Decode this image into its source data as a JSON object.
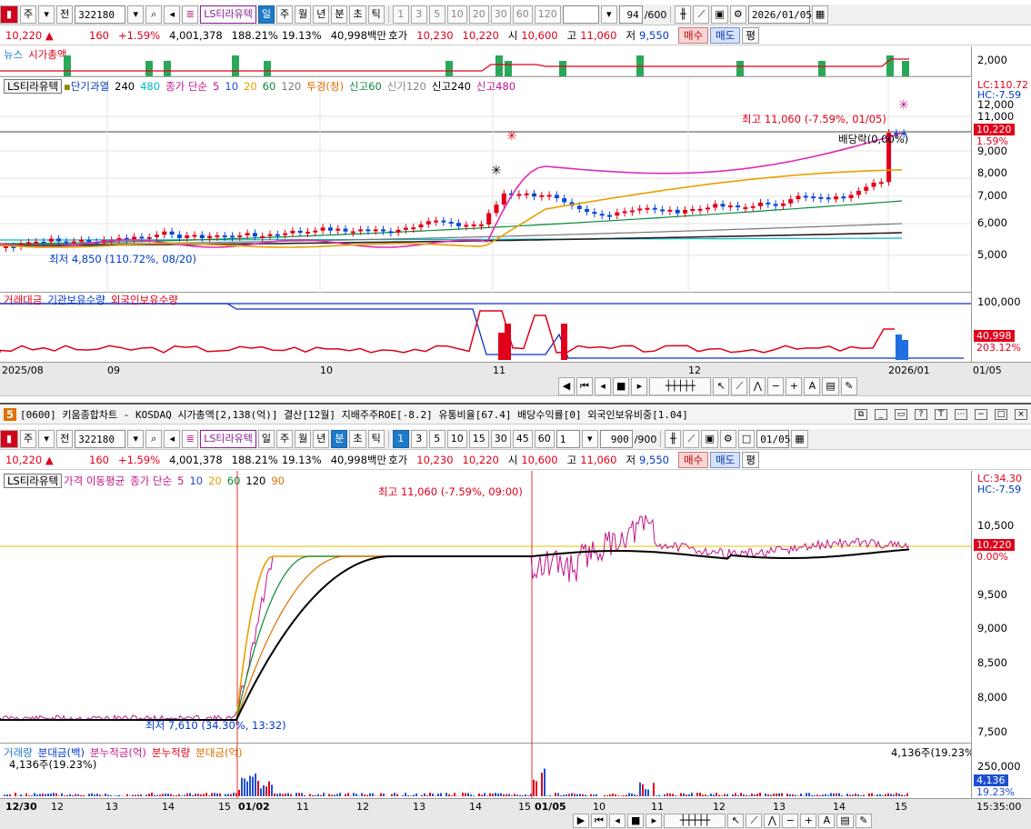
{
  "top_toolbar": {
    "market": "주",
    "prev": "전",
    "code": "322180",
    "stock_name": "LS티라유텍",
    "periods": [
      "일",
      "주",
      "월",
      "년",
      "분",
      "초",
      "틱"
    ],
    "period_selected": "일",
    "intervals": [
      "1",
      "3",
      "5",
      "10",
      "20",
      "30",
      "60",
      "120"
    ],
    "count": "94",
    "count_total": "/600",
    "date": "2026/01/05"
  },
  "top_quote": {
    "price": "10,220",
    "change": "160",
    "change_pct": "+1.59%",
    "volume": "4,001,378",
    "vol_ratio": "188.21%",
    "turnover": "19.13%",
    "amount": "40,998백만",
    "hoga_label": "호가",
    "ask": "10,230",
    "bid": "10,220",
    "open_label": "시",
    "open": "10,600",
    "high_label": "고",
    "high": "11,060",
    "low_label": "저",
    "low": "9,550",
    "buy": "매수",
    "sell": "매도",
    "flat": "평"
  },
  "top_news_legend": {
    "news": "뉴스",
    "mcap": "시가총액"
  },
  "top_news_axis": "2,000",
  "top_price_legend": {
    "name": "LS티라유텍",
    "ma_title": "단기과열",
    "ma_240": "240",
    "ma_480": "480",
    "close_simple": "종가 단순",
    "ma5": "5",
    "ma10": "10",
    "ma20": "20",
    "ma60": "60",
    "ma120": "120",
    "t1": "투경(청)",
    "t2": "신고60",
    "t3": "신가120",
    "t4": "신고240",
    "t5": "신고480"
  },
  "top_price_axis": {
    "lc": "LC:110.72",
    "hc": "HC:-7.59",
    "ticks": [
      "12,000",
      "11,000",
      "9,000",
      "8,000",
      "7,000",
      "6,000",
      "5,000"
    ],
    "current": "10,220",
    "current_pct": "1.59%"
  },
  "top_annotations": {
    "high": "최고 11,060 (-7.59%, 01/05)",
    "dividend": "배당락(0,00%)",
    "low": "최저 4,850 (110.72%, 08/20)"
  },
  "top_volume_legend": {
    "a": "거래대금",
    "b": "기관보유수량",
    "c": "외국인보유수량"
  },
  "top_volume_axis": {
    "tick": "100,000",
    "current": "40,998",
    "pct": "203.12%"
  },
  "top_xaxis": [
    "2025/08",
    "09",
    "10",
    "11",
    "12",
    "2026/01",
    "01/05"
  ],
  "sub_window": {
    "number": "5",
    "title": "[0600] 키움종합차트 - KOSDAQ 시가총액[2,138(억)] 결산[12월] 지배주주ROE[-8.2] 유통비율[67.4] 배당수익률[0] 외국인보유비중[1.04]"
  },
  "bottom_toolbar": {
    "market": "주",
    "prev": "전",
    "code": "322180",
    "stock_name": "LS티라유텍",
    "periods": [
      "일",
      "주",
      "월",
      "년",
      "분",
      "초",
      "틱"
    ],
    "period_selected": "분",
    "intervals": [
      "1",
      "3",
      "5",
      "10",
      "15",
      "30",
      "45",
      "60"
    ],
    "interval_selected": "1",
    "interval_input": "1",
    "count": "900",
    "count_total": "/900",
    "date": "01/05"
  },
  "bottom_price_legend": {
    "name": "LS티라유텍",
    "ma_title": "가격 이동평균",
    "close_simple": "종가 단순",
    "ma5": "5",
    "ma10": "10",
    "ma20": "20",
    "ma60": "60",
    "ma120": "120",
    "ma90": "90"
  },
  "bottom_price_axis": {
    "lc": "LC:34.30",
    "hc": "HC:-7.59",
    "ticks": [
      "10,500",
      "9,500",
      "9,000",
      "8,500",
      "8,000",
      "7,500"
    ],
    "current": "10,220",
    "current_pct": "0.00%"
  },
  "bottom_annotations": {
    "high": "최고 11,060 (-7.59%, 09:00)",
    "low": "최저 7,610 (34.30%, 13:32)"
  },
  "bottom_volume_legend": {
    "a": "거래량",
    "b": "분대금(백)",
    "c": "분누적금(억)",
    "d": "분누적량",
    "e": "분대금(억)"
  },
  "bottom_volume_info": {
    "left": "4,136주(19.23%)",
    "right": "4,136주(19.23%)",
    "tick": "250,000",
    "current": "4,136",
    "pct": "19.23%"
  },
  "bottom_xaxis": [
    "12/30",
    "12",
    "13",
    "14",
    "15",
    "01/02",
    "11",
    "12",
    "13",
    "14",
    "15",
    "01/05",
    "10",
    "11",
    "12",
    "13",
    "14",
    "15",
    "15:35:00"
  ]
}
